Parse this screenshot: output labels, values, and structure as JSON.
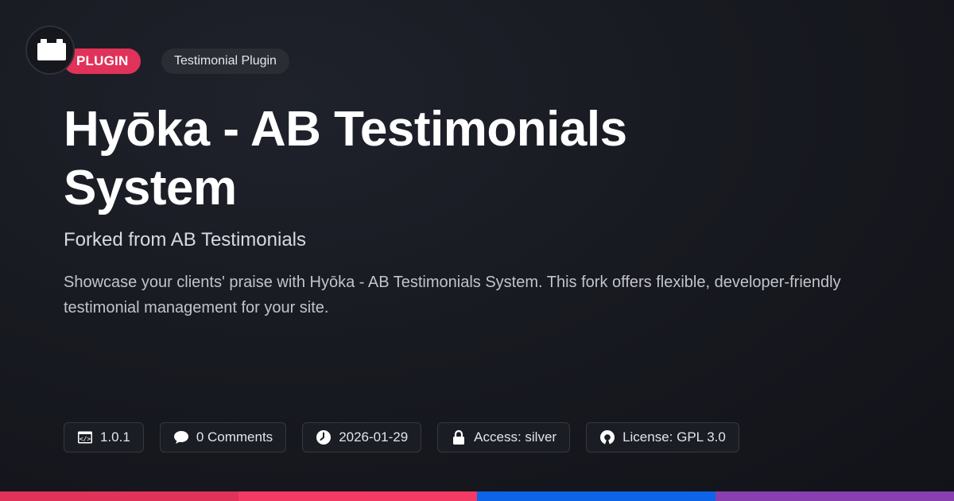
{
  "badges": {
    "type_label": "PLUGIN",
    "category_label": "Testimonial Plugin"
  },
  "title": "Hyōka - AB Testimonials System",
  "subtitle": "Forked from AB Testimonials",
  "description": "Showcase your clients' praise with Hyōka - AB Testimonials System. This fork offers flexible, developer-friendly testimonial management for your site.",
  "meta": {
    "version": "1.0.1",
    "comments": "0 Comments",
    "date": "2026-01-29",
    "access": "Access: silver",
    "license": "License: GPL 3.0"
  },
  "icons": {
    "logo": "brick-icon",
    "version": "code-window-icon",
    "comments": "chat-bubble-icon",
    "date": "clock-icon",
    "access": "lock-icon",
    "license": "open-source-icon"
  },
  "colors": {
    "accent_pink": "#e1325a",
    "bar_1": "#e1325a",
    "bar_2": "#f33a64",
    "bar_3": "#0d64e6",
    "bar_4": "#8a3fb0"
  }
}
